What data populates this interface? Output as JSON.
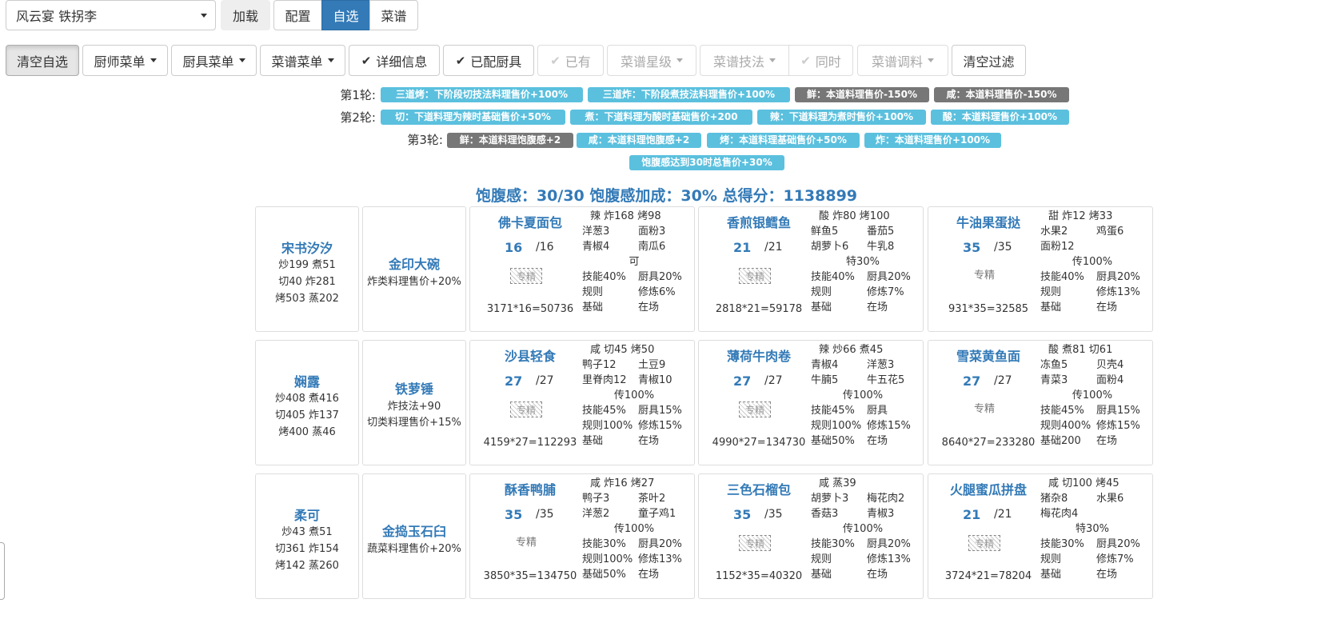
{
  "topbar": {
    "select_value": "风云宴 铁拐李",
    "load_label": "加载",
    "tabs": [
      "配置",
      "自选",
      "菜谱"
    ],
    "active_tab": "自选"
  },
  "toolbar": {
    "clear_selected": "清空自选",
    "chef_menu": "厨师菜单",
    "equip_menu": "厨具菜单",
    "recipe_menu": "菜谱菜单",
    "details": "详细信息",
    "equipped": "已配厨具",
    "owned": "已有",
    "recipe_star": "菜谱星级",
    "recipe_skill": "菜谱技法",
    "same_time": "同时",
    "recipe_condiment": "菜谱调料",
    "clear_filter": "清空过滤"
  },
  "rounds": [
    {
      "label": "第1轮:",
      "tags": [
        {
          "text": "三道烤：下阶段切技法料理售价+100%",
          "color": "blue"
        },
        {
          "text": "三道炸：下阶段煮技法料理售价+100%",
          "color": "blue"
        },
        {
          "text": "鲜：本道料理售价-150%",
          "color": "gray"
        },
        {
          "text": "咸：本道料理售价-150%",
          "color": "gray"
        }
      ]
    },
    {
      "label": "第2轮:",
      "tags": [
        {
          "text": "切：下道料理为辣时基础售价+50%",
          "color": "blue"
        },
        {
          "text": "煮：下道料理为酸时基础售价+200",
          "color": "blue"
        },
        {
          "text": "辣：下道料理为煮时售价+100%",
          "color": "blue"
        },
        {
          "text": "酸：本道料理售价+100%",
          "color": "blue"
        }
      ]
    },
    {
      "label": "第3轮:",
      "tags": [
        {
          "text": "鲜：本道料理饱腹感+2",
          "color": "gray"
        },
        {
          "text": "咸：本道料理饱腹感+2",
          "color": "blue"
        },
        {
          "text": "烤：本道料理基础售价+50%",
          "color": "blue"
        },
        {
          "text": "炸：本道料理售价+100%",
          "color": "blue"
        }
      ]
    }
  ],
  "satiety_bonus_tag": "饱腹感达到30时总售价+30%",
  "summary": "饱腹感：30/30 饱腹感加成：30% 总得分：1138899",
  "rows": [
    {
      "chef": {
        "name": "宋书汐汐",
        "lines": [
          "炒199 煮51",
          "切40 炸281",
          "烤503 蒸202"
        ]
      },
      "equip": {
        "name": "金印大碗",
        "lines": [
          "炸类料理售价+20%"
        ]
      },
      "recipes": [
        {
          "name": "佛卡夏面包",
          "qty": "16",
          "max": "/16",
          "spec": "专精",
          "spec_style": "hatched",
          "score": "3171*16=50736",
          "header": "辣   炸168   烤98",
          "cols": [
            [
              "洋葱3",
              "面粉3"
            ],
            [
              "青椒4",
              "南瓜6"
            ]
          ],
          "extra": "可",
          "stats": [
            [
              "技能40%",
              "厨具20%"
            ],
            [
              "规则",
              "修炼6%"
            ],
            [
              "基础",
              "在场"
            ]
          ]
        },
        {
          "name": "香煎银鳕鱼",
          "qty": "21",
          "max": "/21",
          "spec": "专精",
          "spec_style": "hatched",
          "score": "2818*21=59178",
          "header": "酸   炸80   烤100",
          "cols": [
            [
              "鲜鱼5",
              "番茄5"
            ],
            [
              "胡萝卜6",
              "牛乳8"
            ]
          ],
          "extra": "特30%",
          "stats": [
            [
              "技能40%",
              "厨具20%"
            ],
            [
              "规则",
              "修炼7%"
            ],
            [
              "基础",
              "在场"
            ]
          ]
        },
        {
          "name": "牛油果蛋挞",
          "qty": "35",
          "max": "/35",
          "spec": "专精",
          "spec_style": "plain",
          "score": "931*35=32585",
          "header": "甜   炸12   烤33",
          "cols": [
            [
              "水果2",
              "鸡蛋6"
            ],
            [
              "面粉12",
              ""
            ]
          ],
          "extra": "传100%",
          "stats": [
            [
              "技能40%",
              "厨具20%"
            ],
            [
              "规则",
              "修炼13%"
            ],
            [
              "基础",
              "在场"
            ]
          ]
        }
      ]
    },
    {
      "chef": {
        "name": "娴露",
        "lines": [
          "炒408 煮416",
          "切405 炸137",
          "烤400 蒸46"
        ]
      },
      "equip": {
        "name": "铁萝锤",
        "lines": [
          "炸技法+90",
          "切类料理售价+15%"
        ]
      },
      "recipes": [
        {
          "name": "沙县轻食",
          "qty": "27",
          "max": "/27",
          "spec": "专精",
          "spec_style": "hatched",
          "score": "4159*27=112293",
          "header": "咸   切45   烤50",
          "cols": [
            [
              "鸭子12",
              "土豆9"
            ],
            [
              "里脊肉12",
              "青椒10"
            ]
          ],
          "extra": "传100%",
          "stats": [
            [
              "技能45%",
              "厨具15%"
            ],
            [
              "规则100%",
              "修炼15%"
            ],
            [
              "基础",
              "在场"
            ]
          ]
        },
        {
          "name": "薄荷牛肉卷",
          "qty": "27",
          "max": "/27",
          "spec": "专精",
          "spec_style": "hatched",
          "score": "4990*27=134730",
          "header": "辣   炒66   煮45",
          "cols": [
            [
              "青椒4",
              "洋葱3"
            ],
            [
              "牛腩5",
              "牛五花5"
            ]
          ],
          "extra": "传100%",
          "stats": [
            [
              "技能45%",
              "厨具"
            ],
            [
              "规则100%",
              "修炼15%"
            ],
            [
              "基础50%",
              "在场"
            ]
          ]
        },
        {
          "name": "雪菜黄鱼面",
          "qty": "27",
          "max": "/27",
          "spec": "专精",
          "spec_style": "plain",
          "score": "8640*27=233280",
          "header": "酸   煮81   切61",
          "cols": [
            [
              "冻鱼5",
              "贝壳4"
            ],
            [
              "青菜3",
              "面粉4"
            ]
          ],
          "extra": "传100%",
          "stats": [
            [
              "技能45%",
              "厨具15%"
            ],
            [
              "规则400%",
              "修炼15%"
            ],
            [
              "基础200",
              "在场"
            ]
          ]
        }
      ]
    },
    {
      "chef": {
        "name": "柔可",
        "lines": [
          "炒43 煮51",
          "切361 炸154",
          "烤142 蒸260"
        ]
      },
      "equip": {
        "name": "金捣玉石臼",
        "lines": [
          "蔬菜料理售价+20%"
        ]
      },
      "recipes": [
        {
          "name": "酥香鸭脯",
          "qty": "35",
          "max": "/35",
          "spec": "专精",
          "spec_style": "plain",
          "score": "3850*35=134750",
          "header": "咸   炸16   烤27",
          "cols": [
            [
              "鸭子3",
              "茶叶2"
            ],
            [
              "洋葱2",
              "童子鸡1"
            ]
          ],
          "extra": "传100%",
          "stats": [
            [
              "技能30%",
              "厨具20%"
            ],
            [
              "规则100%",
              "修炼13%"
            ],
            [
              "基础50%",
              "在场"
            ]
          ]
        },
        {
          "name": "三色石榴包",
          "qty": "35",
          "max": "/35",
          "spec": "专精",
          "spec_style": "hatched",
          "score": "1152*35=40320",
          "header": "咸   蒸39",
          "cols": [
            [
              "胡萝卜3",
              "梅花肉2"
            ],
            [
              "香菇3",
              "青椒3"
            ]
          ],
          "extra": "传100%",
          "stats": [
            [
              "技能30%",
              "厨具20%"
            ],
            [
              "规则",
              "修炼13%"
            ],
            [
              "基础",
              "在场"
            ]
          ]
        },
        {
          "name": "火腿蜜瓜拼盘",
          "qty": "21",
          "max": "/21",
          "spec": "专精",
          "spec_style": "hatched",
          "score": "3724*21=78204",
          "header": "咸   切100   烤45",
          "cols": [
            [
              "猪杂8",
              "水果6"
            ],
            [
              "梅花肉4",
              ""
            ]
          ],
          "extra": "特30%",
          "stats": [
            [
              "技能30%",
              "厨具20%"
            ],
            [
              "规则",
              "修炼7%"
            ],
            [
              "基础",
              "在场"
            ]
          ]
        }
      ]
    }
  ]
}
